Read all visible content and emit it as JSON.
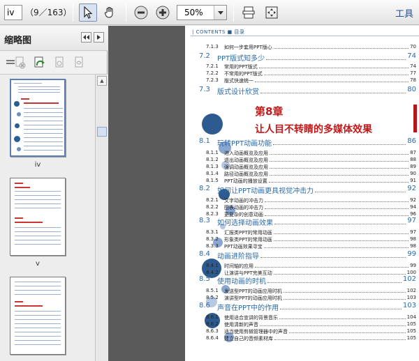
{
  "toolbar": {
    "page_value": "iv",
    "page_count": "（9／163）",
    "zoom_value": "50%",
    "tools_label": "工具"
  },
  "panel": {
    "title": "缩略图",
    "thumbnails": [
      {
        "label": "iv"
      },
      {
        "label": "v"
      },
      {
        "label": ""
      }
    ]
  },
  "doc": {
    "header": "| CONTENTS ■ 目录",
    "prev_entries": [
      {
        "num": "7.1.3",
        "title": "如何一步套用PPT版心",
        "page": "70"
      },
      {
        "num": "7.2",
        "title": "PPT版式知多少",
        "page": "74",
        "section": true
      },
      {
        "num": "7.2.1",
        "title": "常用的PPT版式",
        "page": "74"
      },
      {
        "num": "7.2.2",
        "title": "不常用的PPT版式",
        "page": "77"
      },
      {
        "num": "7.2.3",
        "title": "版式快速统一",
        "page": "78"
      },
      {
        "num": "7.3",
        "title": "版式设计欣赏",
        "page": "80",
        "section": true
      }
    ],
    "chapter": "第8章",
    "chapter_title": "让人目不转睛的多媒体效果",
    "entries": [
      {
        "num": "8.1",
        "title": "玩转PPT动画功能",
        "page": "86",
        "section": true
      },
      {
        "num": "8.1.1",
        "title": "进入动画概览及应用",
        "page": "87"
      },
      {
        "num": "8.1.2",
        "title": "退出动画概览及应用",
        "page": "88"
      },
      {
        "num": "8.1.3",
        "title": "强调动画概览及应用",
        "page": "89"
      },
      {
        "num": "8.1.4",
        "title": "路径动画概览及应用",
        "page": "90"
      },
      {
        "num": "8.1.5",
        "title": "PPT动画的播放设置",
        "page": "91"
      },
      {
        "num": "8.2",
        "title": "如何让PPT动画更具视觉冲击力",
        "page": "92",
        "section": true
      },
      {
        "num": "8.2.1",
        "title": "文字动画的冲击力",
        "page": "92"
      },
      {
        "num": "8.2.2",
        "title": "图表动画的冲击力",
        "page": "94"
      },
      {
        "num": "8.2.3",
        "title": "更复杂的创意动画",
        "page": "96"
      },
      {
        "num": "8.3",
        "title": "如何选择动画效果",
        "page": "97",
        "section": true
      },
      {
        "num": "8.3.1",
        "title": "汇报类PPT的常用动画",
        "page": "97"
      },
      {
        "num": "8.3.2",
        "title": "形象类PPT的常用动画",
        "page": "98"
      },
      {
        "num": "8.3.3",
        "title": "PPT动画效果寻宝",
        "page": "98"
      },
      {
        "num": "8.4",
        "title": "动画进阶指导",
        "page": "99",
        "section": true
      },
      {
        "num": "8.4.1",
        "title": "时间轴的应用",
        "page": "99"
      },
      {
        "num": "8.4.2",
        "title": "让演讲与PPT完美互动",
        "page": "100"
      },
      {
        "num": "8.5",
        "title": "使用动画的时机",
        "page": "102",
        "section": true
      },
      {
        "num": "8.5.1",
        "title": "发送型PPT的动画应用时机",
        "page": "102"
      },
      {
        "num": "8.5.2",
        "title": "演讲型PPT的动画应用时机",
        "page": "103"
      },
      {
        "num": "8.6",
        "title": "声音在PPT中的作用",
        "page": "103",
        "section": true
      },
      {
        "num": "8.6.1",
        "title": "使用适合宣讲的背景音乐",
        "page": "104"
      },
      {
        "num": "8.6.2",
        "title": "使用清新的声音",
        "page": "105"
      },
      {
        "num": "8.6.3",
        "title": "适当使用剪辑管理器中的声音",
        "page": "105"
      },
      {
        "num": "8.6.4",
        "title": "建立自己的音频素材库",
        "page": "105"
      }
    ]
  }
}
